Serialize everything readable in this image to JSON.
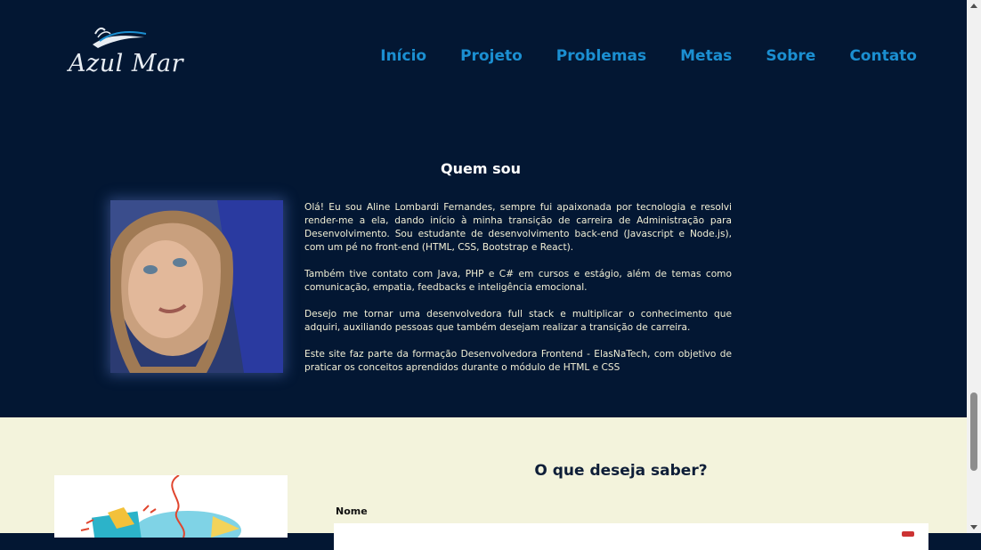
{
  "logo": {
    "text": "Azul Mar"
  },
  "nav": {
    "items": [
      {
        "label": "Início"
      },
      {
        "label": "Projeto"
      },
      {
        "label": "Problemas"
      },
      {
        "label": "Metas"
      },
      {
        "label": "Sobre"
      },
      {
        "label": "Contato"
      }
    ]
  },
  "about": {
    "title": "Quem sou",
    "paragraphs": [
      "Olá! Eu sou Aline Lombardi Fernandes, sempre fui apaixonada por tecnologia e resolvi render-me a ela, dando início à minha transição de carreira de Administração para Desenvolvimento. Sou estudante de desenvolvimento back-end (Javascript e Node.js), com um pé no front-end (HTML, CSS, Bootstrap e React).",
      "Também tive contato com Java, PHP e C# em cursos e estágio, além de temas como comunicação, empatia, feedbacks e inteligência emocional.",
      "Desejo me tornar uma desenvolvedora full stack e multiplicar o conhecimento que adquiri, auxiliando pessoas que também desejam realizar a transição de carreira.",
      "Este site faz parte da formação Desenvolvedora Frontend - ElasNaTech, com objetivo de praticar os conceitos aprendidos durante o módulo de HTML e CSS"
    ]
  },
  "contact": {
    "title": "O que deseja saber?",
    "name_label": "Nome",
    "name_value": ""
  },
  "colors": {
    "header_bg": "#031733",
    "nav_link": "#1b8fd1",
    "about_text": "#f3f0d6",
    "contact_bg": "#f3f3dc"
  }
}
